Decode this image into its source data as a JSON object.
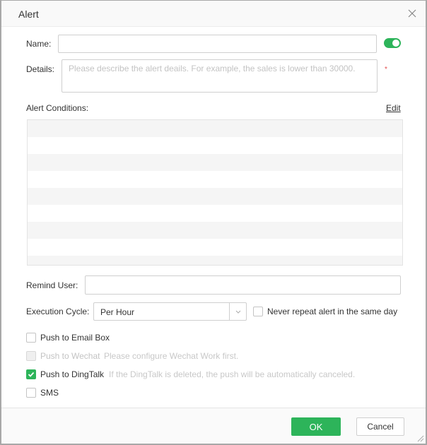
{
  "dialog": {
    "title": "Alert",
    "close_icon": "close-icon"
  },
  "form": {
    "name_label": "Name:",
    "name_value": "",
    "enabled": true,
    "details_label": "Details:",
    "details_placeholder": "Please describe the alert deails. For example, the sales is lower than 30000.",
    "required_mark": "*",
    "conditions_label": "Alert Conditions:",
    "conditions_edit": "Edit",
    "conditions_rows": 9,
    "remind_user_label": "Remind User:",
    "remind_user_value": "",
    "execution_cycle_label": "Execution Cycle:",
    "execution_cycle_value": "Per Hour",
    "never_repeat_label": "Never repeat alert in the same day",
    "never_repeat_checked": false
  },
  "push": [
    {
      "label": "Push to Email Box",
      "checked": false,
      "disabled": false,
      "hint": ""
    },
    {
      "label": "Push to Wechat",
      "checked": false,
      "disabled": true,
      "hint": "Please configure Wechat Work first."
    },
    {
      "label": "Push to DingTalk",
      "checked": true,
      "disabled": false,
      "hint": "If the DingTalk is deleted, the push will be automatically canceled."
    },
    {
      "label": "SMS",
      "checked": false,
      "disabled": false,
      "hint": ""
    }
  ],
  "footer": {
    "ok_label": "OK",
    "cancel_label": "Cancel"
  },
  "colors": {
    "accent": "#2db45a",
    "required": "#e34d4d"
  }
}
